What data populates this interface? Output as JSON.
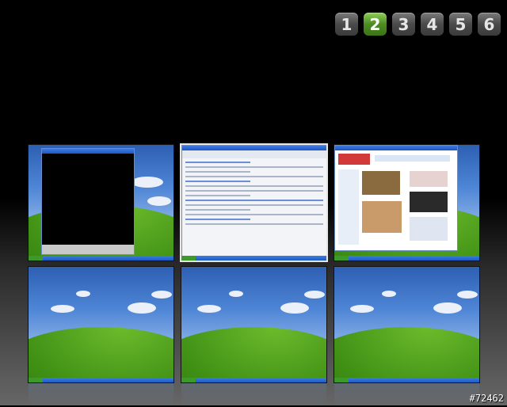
{
  "pager": {
    "pages": [
      "1",
      "2",
      "3",
      "4",
      "5",
      "6"
    ],
    "active_index": 1
  },
  "desktops": [
    {
      "content": "console-window"
    },
    {
      "content": "browser-window"
    },
    {
      "content": "portal-window"
    },
    {
      "content": "empty-desktop"
    },
    {
      "content": "empty-desktop"
    },
    {
      "content": "empty-desktop"
    }
  ],
  "watermark": "#72462",
  "colors": {
    "active_button": "#4b8d21",
    "inactive_button": "#4a4a4a",
    "sky": "#4f86d6",
    "grass": "#3f8f15",
    "taskbar": "#1f5bc2"
  }
}
